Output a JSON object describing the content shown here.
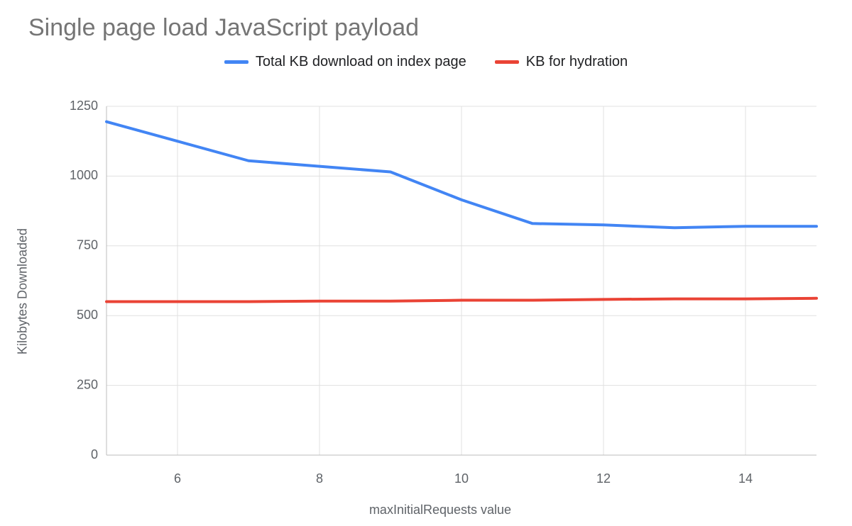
{
  "title": "Single page load JavaScript payload",
  "legend": {
    "series0": "Total KB download on index page",
    "series1": "KB for hydration"
  },
  "xlabel": "maxInitialRequests value",
  "ylabel": "Kilobytes Downloaded",
  "chart_data": {
    "type": "line",
    "xlabel": "maxInitialRequests value",
    "ylabel": "Kilobytes Downloaded",
    "title": "Single page load JavaScript payload",
    "x": [
      5,
      6,
      7,
      8,
      9,
      10,
      11,
      12,
      13,
      14,
      15
    ],
    "series": [
      {
        "name": "Total KB download on index page",
        "color": "#4285f4",
        "values": [
          1195,
          1125,
          1055,
          1035,
          1015,
          915,
          830,
          825,
          815,
          820,
          820
        ]
      },
      {
        "name": "KB for hydration",
        "color": "#ea4335",
        "values": [
          550,
          550,
          550,
          552,
          552,
          555,
          555,
          558,
          560,
          560,
          562
        ]
      }
    ],
    "xlim": [
      5,
      15
    ],
    "ylim": [
      0,
      1250
    ],
    "yticks": [
      0,
      250,
      500,
      750,
      1000,
      1250
    ],
    "xticks": [
      6,
      8,
      10,
      12,
      14
    ],
    "grid": true,
    "legend_position": "top"
  }
}
